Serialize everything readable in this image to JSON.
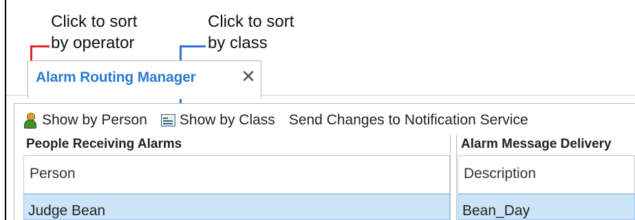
{
  "annotations": {
    "operator": {
      "line1": "Click to sort",
      "line2": "by operator",
      "color": "#e0221c"
    },
    "class": {
      "line1": "Click to sort",
      "line2": "by class",
      "color": "#2f6fd6"
    }
  },
  "tab": {
    "title": "Alarm Routing Manager",
    "close_icon": "close-icon",
    "title_color": "#2b7bd0"
  },
  "toolbar": {
    "items": [
      {
        "label": "Show by Person",
        "icon": "person-icon"
      },
      {
        "label": "Show by Class",
        "icon": "class-card-icon"
      },
      {
        "label": "Send Changes to Notification Service",
        "icon": ""
      }
    ]
  },
  "people_panel": {
    "title": "People Receiving Alarms",
    "column": "Person",
    "rows": [
      "Judge Bean"
    ]
  },
  "delivery_panel": {
    "title": "Alarm Message Delivery",
    "column": "Description",
    "rows": [
      "Bean_Day"
    ]
  },
  "colors": {
    "selection": "#cce4f7"
  }
}
